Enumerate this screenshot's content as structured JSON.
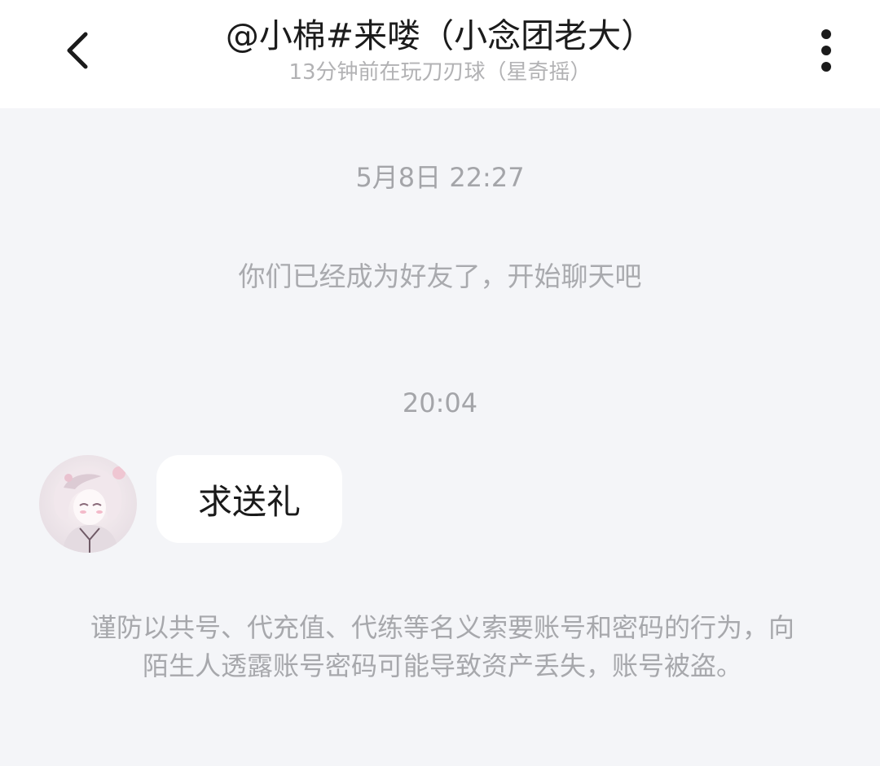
{
  "header": {
    "title": "@小棉#来喽（小念团老大）",
    "subtitle": "13分钟前在玩刀刃球（星奇摇）",
    "back_icon": "chevron-left-icon",
    "more_icon": "more-vertical-icon"
  },
  "chat": {
    "timestamp_1": "5月8日 22:27",
    "system_message": "你们已经成为好友了，开始聊天吧",
    "timestamp_2": "20:04",
    "messages": [
      {
        "text": "求送礼"
      }
    ],
    "warning": "谨防以共号、代充值、代练等名义索要账号和密码的行为，向陌生人透露账号密码可能导致资产丢失，账号被盗。"
  },
  "colors": {
    "background": "#f4f5f8",
    "header": "#ffffff",
    "bubble": "#ffffff",
    "muted_text": "#a7a8ac"
  }
}
